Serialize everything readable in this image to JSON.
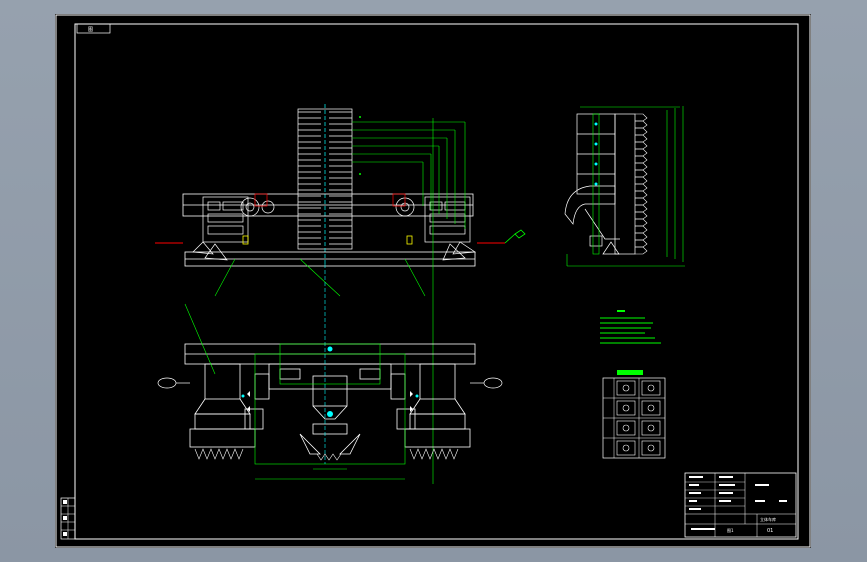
{
  "sheet": {
    "corner_tag": "图",
    "title_block": {
      "title": "立体车库",
      "drawing_no": "01",
      "sheet_label": "图1"
    }
  },
  "colors": {
    "background": "#000000",
    "outline": "#ffffff",
    "dimension": "#00ff00",
    "accent_cyan": "#00ffff",
    "accent_red": "#ff0000",
    "accent_yellow": "#ffff00"
  },
  "icons": {
    "hook": "hook-icon",
    "wheel": "wheel-icon"
  }
}
